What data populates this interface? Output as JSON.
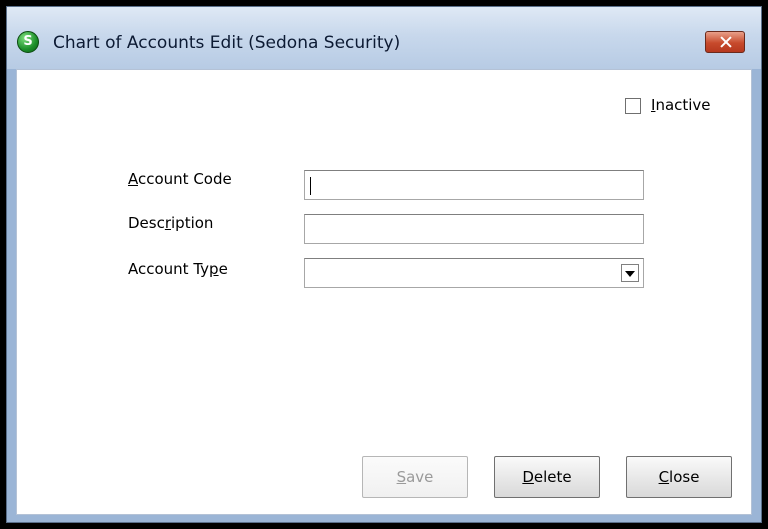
{
  "window": {
    "title": "Chart of Accounts Edit  (Sedona Security)",
    "icon": "sedona-app-icon",
    "icon_letter": "S"
  },
  "form": {
    "inactive": {
      "label_mnemonic": "I",
      "label_rest": "nactive",
      "checked": false
    },
    "account_code": {
      "label_mnemonic": "A",
      "label_rest": "ccount Code",
      "value": ""
    },
    "description": {
      "label_prefix": "Desc",
      "label_mnemonic": "r",
      "label_rest": "iption",
      "value": ""
    },
    "account_type": {
      "label_prefix": "Account Ty",
      "label_mnemonic": "p",
      "label_rest": "e",
      "value": ""
    }
  },
  "buttons": {
    "save": {
      "mnemonic": "S",
      "rest": "ave",
      "enabled": false
    },
    "delete": {
      "mnemonic": "D",
      "rest": "elete",
      "enabled": true
    },
    "close": {
      "mnemonic": "C",
      "rest": "lose",
      "enabled": true
    }
  },
  "colors": {
    "titlebar": "#c8d8ec",
    "close_button": "#c74a2c",
    "app_icon": "#1c8f2a"
  }
}
